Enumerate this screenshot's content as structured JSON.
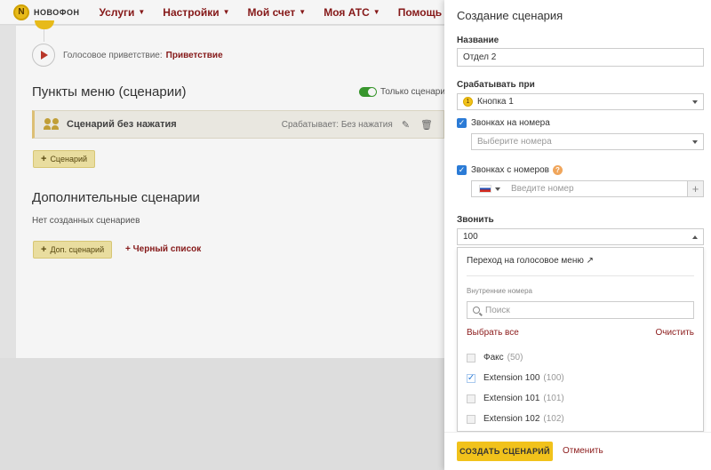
{
  "nav": {
    "logo_text": "НОВОФОН",
    "logo_letter": "N",
    "items": [
      "Услуги",
      "Настройки",
      "Мой счет",
      "Моя АТС",
      "Помощь"
    ]
  },
  "main": {
    "greeting_label": "Голосовое приветствие:",
    "greeting_link": "Приветствие",
    "menu_heading": "Пункты меню (сценарии)",
    "toggle_label": "Только сценарии",
    "card": {
      "title": "Сценарий без нажатия",
      "trigger": "Срабатывает: Без нажатия"
    },
    "add_scenario_label": "Сценарий",
    "extra_heading": "Дополнительные сценарии",
    "no_scenarios": "Нет созданных сценариев",
    "add_extra_label": "Доп. сценарий",
    "blacklist_link": "+ Черный список"
  },
  "panel": {
    "title": "Создание сценария",
    "name_label": "Название",
    "name_value": "Отдел 2",
    "trigger_label": "Срабатывать при",
    "trigger_badge": "1",
    "trigger_value": "Кнопка 1",
    "calls_to_label": "Звонках на номера",
    "calls_to_placeholder": "Выберите номера",
    "calls_from_label": "Звонках с номеров",
    "help_glyph": "?",
    "phone_placeholder": "Введите номер",
    "phone_add": "+",
    "call_label": "Звонить",
    "call_value": "100",
    "dropdown": {
      "voice_menu_link": "Переход на голосовое меню ↗",
      "section": "Внутренние номера",
      "search_placeholder": "Поиск",
      "select_all": "Выбрать все",
      "clear": "Очистить",
      "options": [
        {
          "name": "Факс",
          "count": "(50)",
          "checked": false
        },
        {
          "name": "Extension 100",
          "count": "(100)",
          "checked": true
        },
        {
          "name": "Extension 101",
          "count": "(101)",
          "checked": false
        },
        {
          "name": "Extension 102",
          "count": "(102)",
          "checked": false
        }
      ]
    },
    "create_button": "СОЗДАТЬ СЦЕНАРИЙ",
    "cancel_link": "Отменить"
  },
  "colors": {
    "brand_yellow": "#f1c21b",
    "link_red": "#8b1a1a",
    "checkbox_blue": "#2b7bd6",
    "toggle_green": "#3b9d2f"
  }
}
